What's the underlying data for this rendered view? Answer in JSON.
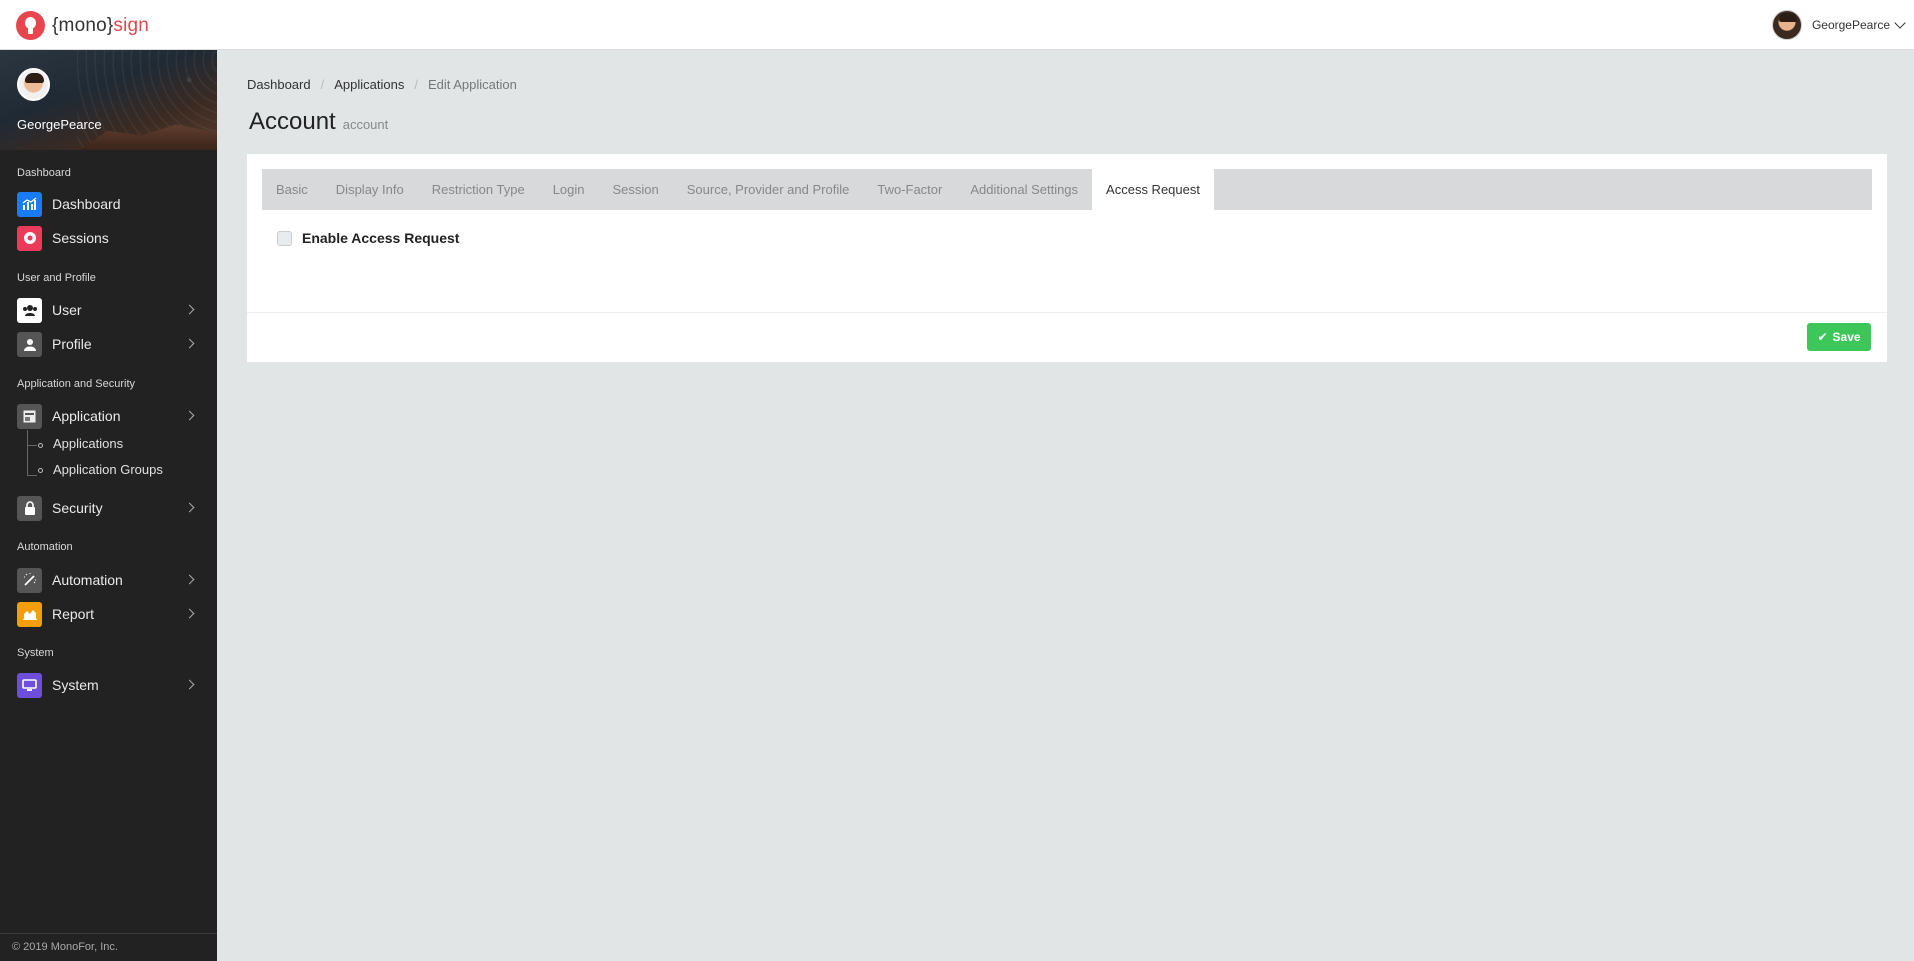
{
  "brand": {
    "prefix": "{mono}",
    "suffix": "sign",
    "accent_color": "#e8464e"
  },
  "topbar": {
    "username": "GeorgePearce"
  },
  "sidebar": {
    "username": "GeorgePearce",
    "sections": {
      "dashboard": "Dashboard",
      "user_profile": "User and Profile",
      "app_security": "Application and Security",
      "automation": "Automation",
      "system": "System"
    },
    "items": {
      "dashboard": {
        "label": "Dashboard",
        "icon": "chart-icon",
        "color": "#1a7cf5"
      },
      "sessions": {
        "label": "Sessions",
        "icon": "record-icon",
        "color": "#ec3a5a"
      },
      "user": {
        "label": "User",
        "icon": "users-icon",
        "color": "#ffffff"
      },
      "profile": {
        "label": "Profile",
        "icon": "person-icon",
        "color": "#555555"
      },
      "application": {
        "label": "Application",
        "icon": "window-icon",
        "color": "#555555"
      },
      "security": {
        "label": "Security",
        "icon": "lock-icon",
        "color": "#555555"
      },
      "automation": {
        "label": "Automation",
        "icon": "magic-wand-icon",
        "color": "#555555"
      },
      "report": {
        "label": "Report",
        "icon": "area-chart-icon",
        "color": "#f59e0b"
      },
      "system": {
        "label": "System",
        "icon": "monitor-icon",
        "color": "#6d4fdc"
      }
    },
    "sub_items": [
      "Applications",
      "Application Groups"
    ],
    "footer": "© 2019 MonoFor, Inc."
  },
  "breadcrumb": [
    "Dashboard",
    "Applications",
    "Edit Application"
  ],
  "page": {
    "title": "Account",
    "subtitle": "account"
  },
  "tabs": [
    "Basic",
    "Display Info",
    "Restriction Type",
    "Login",
    "Session",
    "Source, Provider and Profile",
    "Two-Factor",
    "Additional Settings",
    "Access Request"
  ],
  "active_tab": "Access Request",
  "form": {
    "enable_access_request_label": "Enable Access Request",
    "enable_access_request_checked": false
  },
  "actions": {
    "save_label": "Save",
    "save_color": "#3dc65a"
  }
}
